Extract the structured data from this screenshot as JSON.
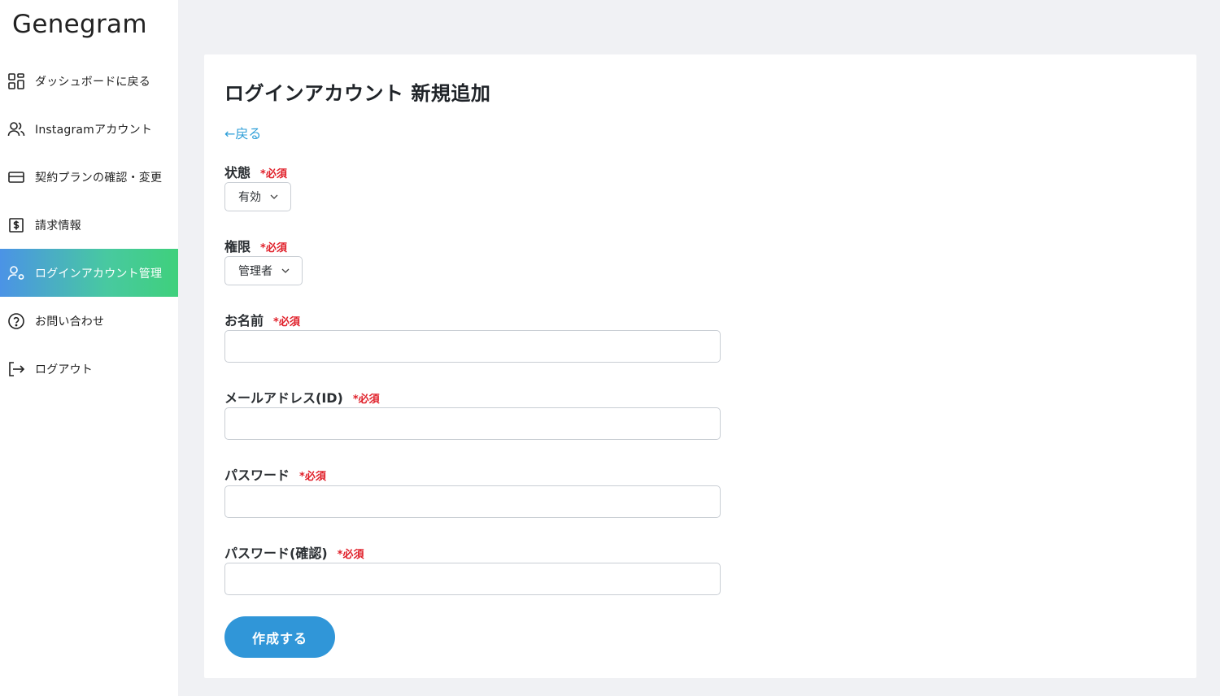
{
  "app": {
    "logo": "Genegram"
  },
  "sidebar": {
    "items": [
      {
        "label": "ダッシュボードに戻る",
        "icon": "dashboard-grid-icon",
        "active": false
      },
      {
        "label": "Instagramアカウント",
        "icon": "users-icon",
        "active": false
      },
      {
        "label": "契約プランの確認・変更",
        "icon": "credit-card-icon",
        "active": false
      },
      {
        "label": "請求情報",
        "icon": "invoice-dollar-icon",
        "active": false
      },
      {
        "label": "ログインアカウント管理",
        "icon": "user-gear-icon",
        "active": true
      },
      {
        "label": "お問い合わせ",
        "icon": "question-circle-icon",
        "active": false
      },
      {
        "label": "ログアウト",
        "icon": "logout-icon",
        "active": false
      }
    ]
  },
  "main": {
    "title": "ログインアカウント 新規追加",
    "back_link": "←戻る",
    "required_mark": "*必須",
    "fields": {
      "status": {
        "label": "状態",
        "value": "有効"
      },
      "role": {
        "label": "権限",
        "value": "管理者"
      },
      "name": {
        "label": "お名前",
        "value": "",
        "placeholder": ""
      },
      "email": {
        "label": "メールアドレス(ID)",
        "value": "",
        "placeholder": ""
      },
      "password": {
        "label": "パスワード",
        "value": "",
        "placeholder": ""
      },
      "password_confirm": {
        "label": "パスワード(確認)",
        "value": "",
        "placeholder": ""
      }
    },
    "submit_label": "作成する"
  },
  "colors": {
    "accent": "#3096d8",
    "required": "#e0202a",
    "active_gradient_start": "#4b93e6",
    "active_gradient_end": "#3fd07c",
    "background": "#f0f1f4"
  }
}
